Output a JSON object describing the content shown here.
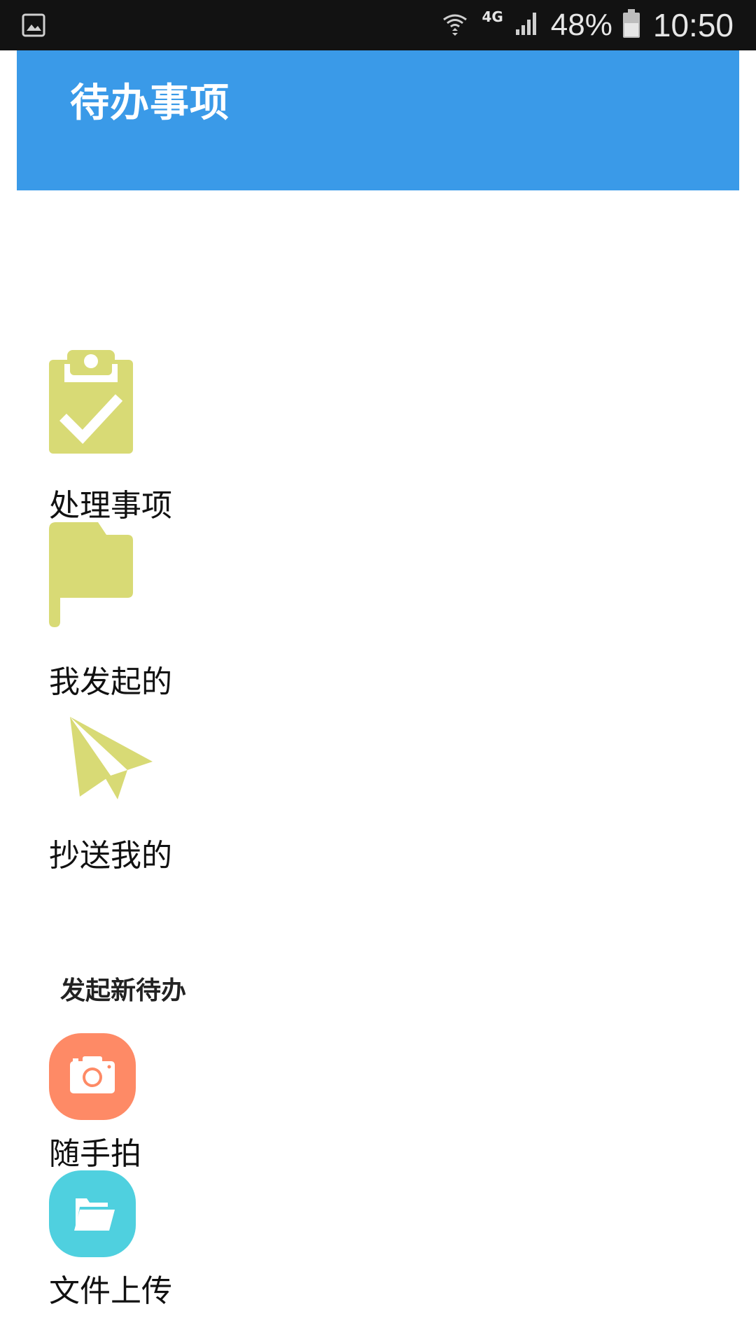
{
  "status_bar": {
    "network_type": "4G",
    "battery_percent": "48%",
    "time": "10:50"
  },
  "header": {
    "title": "待办事项"
  },
  "menu": {
    "items": [
      {
        "label": "处理事项",
        "icon": "clipboard-check-icon"
      },
      {
        "label": "我发起的",
        "icon": "flag-icon"
      },
      {
        "label": "抄送我的",
        "icon": "paper-plane-icon"
      }
    ]
  },
  "new_todo": {
    "title": "发起新待办",
    "actions": [
      {
        "label": "随手拍",
        "icon": "camera-icon",
        "color": "#fe8a66"
      },
      {
        "label": "文件上传",
        "icon": "folder-icon",
        "color": "#4fd0df"
      }
    ]
  },
  "colors": {
    "header": "#3a9ae8",
    "icon_yellow": "#d8da75",
    "camera_bg": "#fe8a66",
    "upload_bg": "#4fd0df"
  }
}
